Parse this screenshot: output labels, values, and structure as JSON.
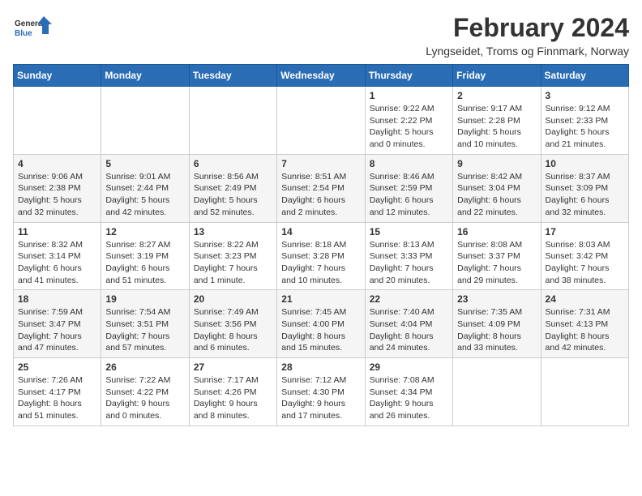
{
  "header": {
    "logo_general": "General",
    "logo_blue": "Blue",
    "month_title": "February 2024",
    "location": "Lyngseidet, Troms og Finnmark, Norway"
  },
  "days_of_week": [
    "Sunday",
    "Monday",
    "Tuesday",
    "Wednesday",
    "Thursday",
    "Friday",
    "Saturday"
  ],
  "weeks": [
    {
      "days": [
        {
          "number": "",
          "info": ""
        },
        {
          "number": "",
          "info": ""
        },
        {
          "number": "",
          "info": ""
        },
        {
          "number": "",
          "info": ""
        },
        {
          "number": "1",
          "info": "Sunrise: 9:22 AM\nSunset: 2:22 PM\nDaylight: 5 hours\nand 0 minutes."
        },
        {
          "number": "2",
          "info": "Sunrise: 9:17 AM\nSunset: 2:28 PM\nDaylight: 5 hours\nand 10 minutes."
        },
        {
          "number": "3",
          "info": "Sunrise: 9:12 AM\nSunset: 2:33 PM\nDaylight: 5 hours\nand 21 minutes."
        }
      ]
    },
    {
      "days": [
        {
          "number": "4",
          "info": "Sunrise: 9:06 AM\nSunset: 2:38 PM\nDaylight: 5 hours\nand 32 minutes."
        },
        {
          "number": "5",
          "info": "Sunrise: 9:01 AM\nSunset: 2:44 PM\nDaylight: 5 hours\nand 42 minutes."
        },
        {
          "number": "6",
          "info": "Sunrise: 8:56 AM\nSunset: 2:49 PM\nDaylight: 5 hours\nand 52 minutes."
        },
        {
          "number": "7",
          "info": "Sunrise: 8:51 AM\nSunset: 2:54 PM\nDaylight: 6 hours\nand 2 minutes."
        },
        {
          "number": "8",
          "info": "Sunrise: 8:46 AM\nSunset: 2:59 PM\nDaylight: 6 hours\nand 12 minutes."
        },
        {
          "number": "9",
          "info": "Sunrise: 8:42 AM\nSunset: 3:04 PM\nDaylight: 6 hours\nand 22 minutes."
        },
        {
          "number": "10",
          "info": "Sunrise: 8:37 AM\nSunset: 3:09 PM\nDaylight: 6 hours\nand 32 minutes."
        }
      ]
    },
    {
      "days": [
        {
          "number": "11",
          "info": "Sunrise: 8:32 AM\nSunset: 3:14 PM\nDaylight: 6 hours\nand 41 minutes."
        },
        {
          "number": "12",
          "info": "Sunrise: 8:27 AM\nSunset: 3:19 PM\nDaylight: 6 hours\nand 51 minutes."
        },
        {
          "number": "13",
          "info": "Sunrise: 8:22 AM\nSunset: 3:23 PM\nDaylight: 7 hours\nand 1 minute."
        },
        {
          "number": "14",
          "info": "Sunrise: 8:18 AM\nSunset: 3:28 PM\nDaylight: 7 hours\nand 10 minutes."
        },
        {
          "number": "15",
          "info": "Sunrise: 8:13 AM\nSunset: 3:33 PM\nDaylight: 7 hours\nand 20 minutes."
        },
        {
          "number": "16",
          "info": "Sunrise: 8:08 AM\nSunset: 3:37 PM\nDaylight: 7 hours\nand 29 minutes."
        },
        {
          "number": "17",
          "info": "Sunrise: 8:03 AM\nSunset: 3:42 PM\nDaylight: 7 hours\nand 38 minutes."
        }
      ]
    },
    {
      "days": [
        {
          "number": "18",
          "info": "Sunrise: 7:59 AM\nSunset: 3:47 PM\nDaylight: 7 hours\nand 47 minutes."
        },
        {
          "number": "19",
          "info": "Sunrise: 7:54 AM\nSunset: 3:51 PM\nDaylight: 7 hours\nand 57 minutes."
        },
        {
          "number": "20",
          "info": "Sunrise: 7:49 AM\nSunset: 3:56 PM\nDaylight: 8 hours\nand 6 minutes."
        },
        {
          "number": "21",
          "info": "Sunrise: 7:45 AM\nSunset: 4:00 PM\nDaylight: 8 hours\nand 15 minutes."
        },
        {
          "number": "22",
          "info": "Sunrise: 7:40 AM\nSunset: 4:04 PM\nDaylight: 8 hours\nand 24 minutes."
        },
        {
          "number": "23",
          "info": "Sunrise: 7:35 AM\nSunset: 4:09 PM\nDaylight: 8 hours\nand 33 minutes."
        },
        {
          "number": "24",
          "info": "Sunrise: 7:31 AM\nSunset: 4:13 PM\nDaylight: 8 hours\nand 42 minutes."
        }
      ]
    },
    {
      "days": [
        {
          "number": "25",
          "info": "Sunrise: 7:26 AM\nSunset: 4:17 PM\nDaylight: 8 hours\nand 51 minutes."
        },
        {
          "number": "26",
          "info": "Sunrise: 7:22 AM\nSunset: 4:22 PM\nDaylight: 9 hours\nand 0 minutes."
        },
        {
          "number": "27",
          "info": "Sunrise: 7:17 AM\nSunset: 4:26 PM\nDaylight: 9 hours\nand 8 minutes."
        },
        {
          "number": "28",
          "info": "Sunrise: 7:12 AM\nSunset: 4:30 PM\nDaylight: 9 hours\nand 17 minutes."
        },
        {
          "number": "29",
          "info": "Sunrise: 7:08 AM\nSunset: 4:34 PM\nDaylight: 9 hours\nand 26 minutes."
        },
        {
          "number": "",
          "info": ""
        },
        {
          "number": "",
          "info": ""
        }
      ]
    }
  ]
}
